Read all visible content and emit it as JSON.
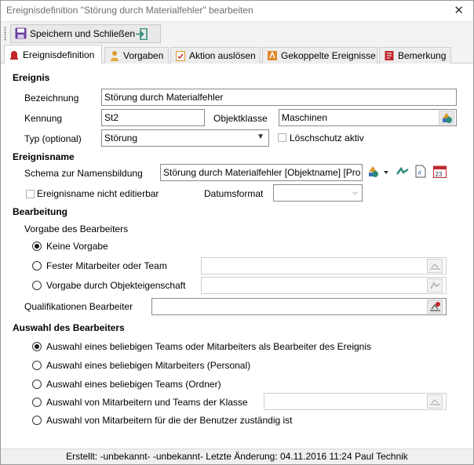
{
  "window": {
    "title": "Ereignisdefinition \"Störung durch Materialfehler\" bearbeiten"
  },
  "toolbar": {
    "save_close_label": "Speichern und Schließen"
  },
  "tabs": [
    {
      "label": "Ereignisdefinition"
    },
    {
      "label": "Vorgaben"
    },
    {
      "label": "Aktion auslösen"
    },
    {
      "label": "Gekoppelte Ereignisse"
    },
    {
      "label": "Bemerkung"
    }
  ],
  "ereignis": {
    "section": "Ereignis",
    "bezeichnung_label": "Bezeichnung",
    "bezeichnung_value": "Störung durch Materialfehler",
    "kennung_label": "Kennung",
    "kennung_value": "St2",
    "objektklasse_label": "Objektklasse",
    "objektklasse_value": "Maschinen",
    "typ_label": "Typ (optional)",
    "typ_value": "Störung",
    "loeschschutz_label": "Löschschutz aktiv"
  },
  "ereignisname": {
    "section": "Ereignisname",
    "schema_label": "Schema zur Namensbildung",
    "schema_value": "Störung durch Materialfehler [Objektname] [Pro",
    "nicht_editierbar_label": "Ereignisname nicht editierbar",
    "datumsformat_label": "Datumsformat",
    "datumsformat_value": "",
    "calendar_day": "23"
  },
  "bearbeitung": {
    "section": "Bearbeitung",
    "vorgabe_label": "Vorgabe des Bearbeiters",
    "options": [
      {
        "label": "Keine Vorgabe",
        "selected": true
      },
      {
        "label": "Fester Mitarbeiter oder Team",
        "selected": false
      },
      {
        "label": "Vorgabe durch Objekteigenschaft",
        "selected": false
      }
    ],
    "qualifikationen_label": "Qualifikationen Bearbeiter"
  },
  "auswahl": {
    "section": "Auswahl des Bearbeiters",
    "options": [
      {
        "label": "Auswahl eines beliebigen Teams oder Mitarbeiters als Bearbeiter des Ereignis",
        "selected": true
      },
      {
        "label": "Auswahl eines beliebigen Mitarbeiters (Personal)",
        "selected": false
      },
      {
        "label": "Auswahl eines beliebigen Teams (Ordner)",
        "selected": false
      },
      {
        "label": "Auswahl von Mitarbeitern und Teams der Klasse",
        "selected": false
      },
      {
        "label": "Auswahl von Mitarbeitern für die der Benutzer zuständig ist",
        "selected": false
      }
    ]
  },
  "status": {
    "text": "Erstellt: -unbekannt- -unbekannt-  Letzte Änderung: 04.11.2016 11:24 Paul Technik"
  },
  "colors": {
    "accent_red": "#c0272d",
    "save_purple": "#6b3fa0",
    "teal": "#2e8b7a"
  }
}
